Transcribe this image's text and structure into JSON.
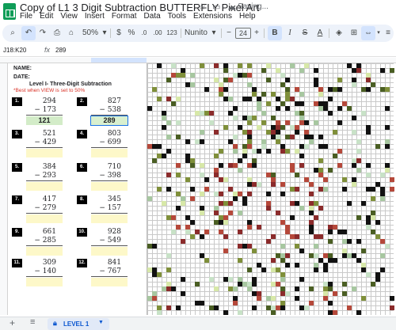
{
  "app": {
    "title": "Copy of L1 3 Digit Subtraction BUTTERFLY Pixel Art",
    "status": "Saving...",
    "menus": [
      "File",
      "Edit",
      "View",
      "Insert",
      "Format",
      "Data",
      "Tools",
      "Extensions",
      "Help"
    ]
  },
  "toolbar": {
    "zoom": "50%",
    "currency": "$",
    "percent": "%",
    "dec_decrease": ".0",
    "dec_increase": ".00",
    "number_format": "123",
    "font": "Nunito",
    "font_size": "24",
    "bold": "B",
    "italic": "I",
    "strike": "S",
    "text_color": "A"
  },
  "formula_bar": {
    "name_box": "J18:K20",
    "fx": "fx",
    "value": "289"
  },
  "worksheet": {
    "name_label": "NAME:",
    "date_label": "DATE:",
    "level_title": "Level I- Three-Digit Subtraction",
    "note": "*Best when VIEW is set to 50%"
  },
  "problems": [
    {
      "num": "1.",
      "top": "294",
      "bottom": "− 173",
      "answer": "121"
    },
    {
      "num": "2.",
      "top": "827",
      "bottom": "− 538",
      "answer": "289"
    },
    {
      "num": "3.",
      "top": "521",
      "bottom": "− 429",
      "answer": ""
    },
    {
      "num": "4.",
      "top": "803",
      "bottom": "− 699",
      "answer": ""
    },
    {
      "num": "5.",
      "top": "384",
      "bottom": "− 293",
      "answer": ""
    },
    {
      "num": "6.",
      "top": "710",
      "bottom": "− 398",
      "answer": ""
    },
    {
      "num": "7.",
      "top": "417",
      "bottom": "− 279",
      "answer": ""
    },
    {
      "num": "8.",
      "top": "345",
      "bottom": "− 157",
      "answer": ""
    },
    {
      "num": "9.",
      "top": "661",
      "bottom": "− 285",
      "answer": ""
    },
    {
      "num": "10.",
      "top": "928",
      "bottom": "− 549",
      "answer": ""
    },
    {
      "num": "11.",
      "top": "309",
      "bottom": "− 140",
      "answer": ""
    },
    {
      "num": "12.",
      "top": "841",
      "bottom": "− 767",
      "answer": ""
    }
  ],
  "pixel_colors": [
    "#111111",
    "#111111",
    "#111111",
    "#4a5e23",
    "#7f8f3a",
    "#8b2b2b",
    "#b5483a",
    "#a7c7a0",
    "#c8e2c7",
    "#d7e8a8"
  ],
  "sheet_tab": {
    "label": "LEVEL 1"
  }
}
